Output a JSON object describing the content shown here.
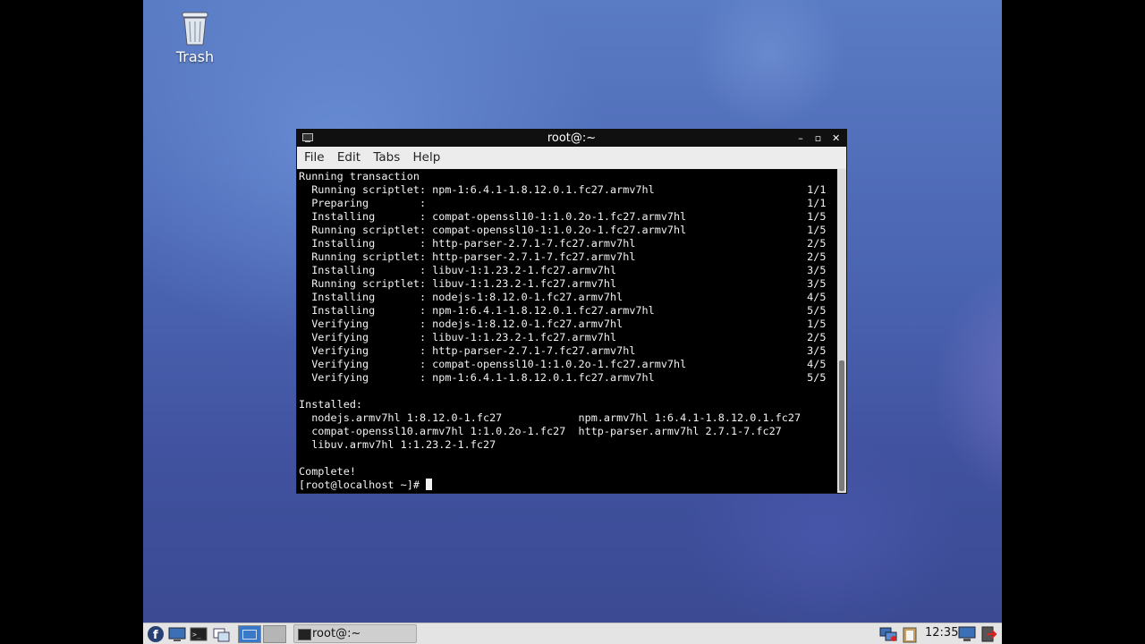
{
  "desktop": {
    "icons": [
      {
        "label": "Trash",
        "icon": "trash-icon"
      }
    ]
  },
  "terminal": {
    "title": "root@:~",
    "menu": [
      "File",
      "Edit",
      "Tabs",
      "Help"
    ],
    "lines": [
      "Running transaction",
      "  Running scriptlet: npm-1:6.4.1-1.8.12.0.1.fc27.armv7hl                        1/1",
      "  Preparing        :                                                            1/1",
      "  Installing       : compat-openssl10-1:1.0.2o-1.fc27.armv7hl                   1/5",
      "  Running scriptlet: compat-openssl10-1:1.0.2o-1.fc27.armv7hl                   1/5",
      "  Installing       : http-parser-2.7.1-7.fc27.armv7hl                           2/5",
      "  Running scriptlet: http-parser-2.7.1-7.fc27.armv7hl                           2/5",
      "  Installing       : libuv-1:1.23.2-1.fc27.armv7hl                              3/5",
      "  Running scriptlet: libuv-1:1.23.2-1.fc27.armv7hl                              3/5",
      "  Installing       : nodejs-1:8.12.0-1.fc27.armv7hl                             4/5",
      "  Installing       : npm-1:6.4.1-1.8.12.0.1.fc27.armv7hl                        5/5",
      "  Verifying        : nodejs-1:8.12.0-1.fc27.armv7hl                             1/5",
      "  Verifying        : libuv-1:1.23.2-1.fc27.armv7hl                              2/5",
      "  Verifying        : http-parser-2.7.1-7.fc27.armv7hl                           3/5",
      "  Verifying        : compat-openssl10-1:1.0.2o-1.fc27.armv7hl                   4/5",
      "  Verifying        : npm-1:6.4.1-1.8.12.0.1.fc27.armv7hl                        5/5",
      "",
      "Installed:",
      "  nodejs.armv7hl 1:8.12.0-1.fc27            npm.armv7hl 1:6.4.1-1.8.12.0.1.fc27",
      "  compat-openssl10.armv7hl 1:1.0.2o-1.fc27  http-parser.armv7hl 2.7.1-7.fc27",
      "  libuv.armv7hl 1:1.23.2-1.fc27",
      "",
      "Complete!"
    ],
    "prompt": "[root@localhost ~]# "
  },
  "taskbar": {
    "task_label": "root@:~",
    "clock": "12:35",
    "launchers": [
      "fedora-menu-icon",
      "file-manager-icon",
      "terminal-icon",
      "window-list-icon"
    ],
    "tray": [
      "network-icon",
      "clipboard-icon",
      "display-icon",
      "logout-icon"
    ]
  }
}
